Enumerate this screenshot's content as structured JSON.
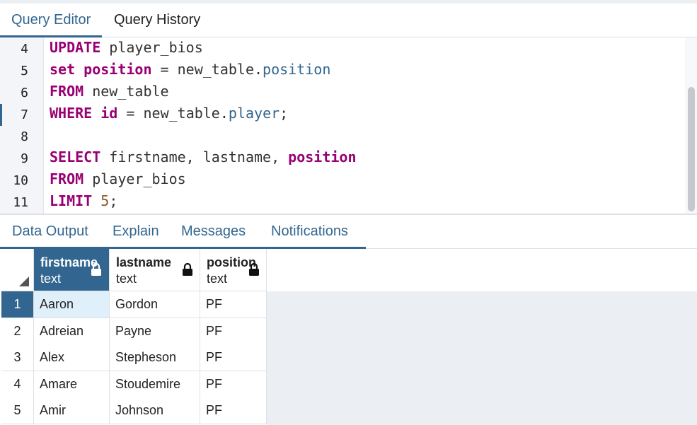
{
  "editor_tabs": [
    {
      "label": "Query Editor",
      "active": true
    },
    {
      "label": "Query History",
      "active": false
    }
  ],
  "editor": {
    "line_numbers": [
      "4",
      "5",
      "6",
      "7",
      "8",
      "9",
      "10",
      "11"
    ],
    "lines": [
      [
        {
          "t": "UPDATE",
          "c": "kw"
        },
        {
          "t": " player_bios",
          "c": ""
        }
      ],
      [
        {
          "t": "set",
          "c": "kw"
        },
        {
          "t": " ",
          "c": ""
        },
        {
          "t": "position",
          "c": "kw"
        },
        {
          "t": " = new_table.",
          "c": ""
        },
        {
          "t": "position",
          "c": "mem"
        }
      ],
      [
        {
          "t": "FROM",
          "c": "kw"
        },
        {
          "t": " new_table",
          "c": ""
        }
      ],
      [
        {
          "t": "WHERE",
          "c": "kw"
        },
        {
          "t": " ",
          "c": ""
        },
        {
          "t": "id",
          "c": "kw"
        },
        {
          "t": " = new_table.",
          "c": ""
        },
        {
          "t": "player",
          "c": "mem"
        },
        {
          "t": ";",
          "c": ""
        }
      ],
      [],
      [
        {
          "t": "SELECT",
          "c": "kw"
        },
        {
          "t": " firstname, lastname, ",
          "c": ""
        },
        {
          "t": "position",
          "c": "kw"
        }
      ],
      [
        {
          "t": "FROM",
          "c": "kw"
        },
        {
          "t": " player_bios",
          "c": ""
        }
      ],
      [
        {
          "t": "LIMIT",
          "c": "kw"
        },
        {
          "t": " ",
          "c": ""
        },
        {
          "t": "5",
          "c": "num"
        },
        {
          "t": ";",
          "c": ""
        }
      ]
    ]
  },
  "output_tabs": [
    {
      "label": "Data Output",
      "active": true
    },
    {
      "label": "Explain",
      "active": false
    },
    {
      "label": "Messages",
      "active": false
    },
    {
      "label": "Notifications",
      "active": false
    }
  ],
  "grid": {
    "columns": [
      {
        "name": "firstname",
        "type": "text",
        "selected": true
      },
      {
        "name": "lastname",
        "type": "text",
        "selected": false
      },
      {
        "name": "position",
        "type": "text",
        "selected": false
      }
    ],
    "rows": [
      {
        "n": "1",
        "cells": [
          "Aaron",
          "Gordon",
          "PF"
        ]
      },
      {
        "n": "2",
        "cells": [
          "Adreian",
          "Payne",
          "PF"
        ]
      },
      {
        "n": "3",
        "cells": [
          "Alex",
          "Stepheson",
          "PF"
        ]
      },
      {
        "n": "4",
        "cells": [
          "Amare",
          "Stoudemire",
          "PF"
        ]
      },
      {
        "n": "5",
        "cells": [
          "Amir",
          "Johnson",
          "PF"
        ]
      }
    ],
    "selected_row": "1"
  },
  "colors": {
    "accent": "#326690",
    "keyword": "#990073",
    "member": "#326690",
    "number": "#8a5a2c",
    "selected_cell": "#dff0fa",
    "empty_area": "#ebeef3"
  }
}
